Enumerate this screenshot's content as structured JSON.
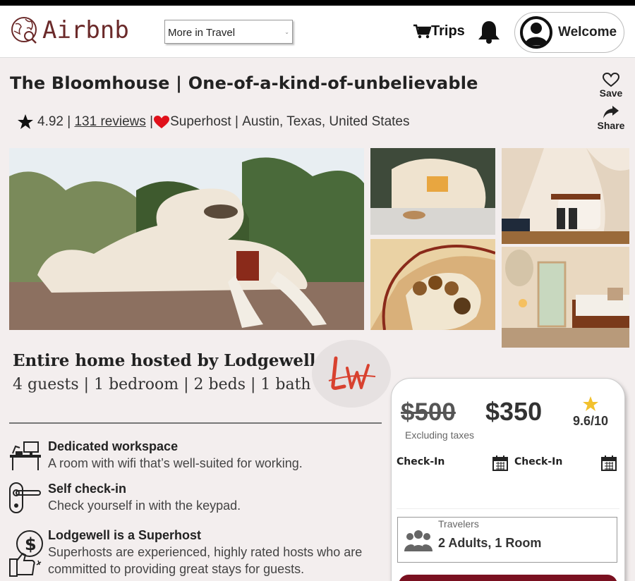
{
  "brand": {
    "name": "Airbnb",
    "color": "#6b2a2a"
  },
  "header": {
    "dropdown_value": "More in Travel",
    "trips_label": "Trips",
    "welcome_label": "Welcome"
  },
  "listing": {
    "title": "The Bloomhouse | One-of-a-kind-of-unbelievable",
    "rating": "4.92",
    "reviews_link": "131 reviews",
    "superhost_label": "Superhost",
    "location": "Austin, Texas, United States",
    "save_label": "Save",
    "share_label": "Share"
  },
  "host": {
    "title": "Entire home hosted by Lodgewell",
    "summary": "4 guests | 1 bedroom | 2 beds | 1 bath"
  },
  "features": [
    {
      "title": "Dedicated workspace",
      "desc": "A room with wifi that’s well-suited for working."
    },
    {
      "title": "Self check-in",
      "desc": "Check yourself in with the keypad."
    },
    {
      "title": "Lodgewell is a Superhost",
      "desc": "Superhosts are experienced, highly rated hosts who are committed to providing great stays for guests."
    }
  ],
  "booking": {
    "old_price": "$500",
    "new_price": "$350",
    "tax_note": "Excluding taxes",
    "score": "9.6/10",
    "checkin_label_1": "Check-In",
    "checkin_label_2": "Check-In",
    "travelers_label": "Travelers",
    "travelers_value": "2 Adults, 1 Room",
    "button_color": "#7a1020"
  }
}
